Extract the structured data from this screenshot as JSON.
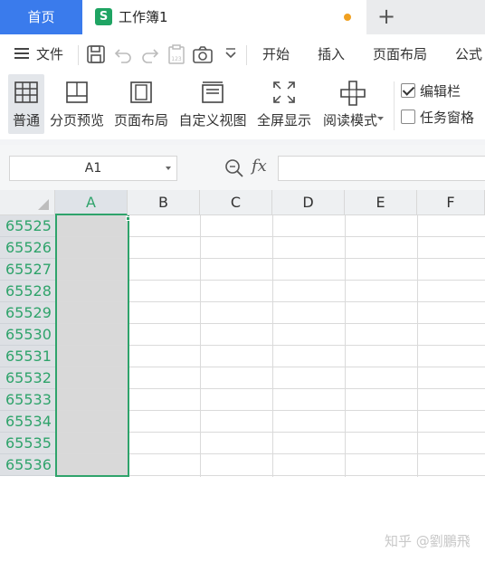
{
  "tabs": {
    "home_label": "首页",
    "doc_icon_letter": "S",
    "doc_title": "工作簿1",
    "new_tab_symbol": "+"
  },
  "menu": {
    "file_label": "文件",
    "items": [
      "开始",
      "插入",
      "页面布局",
      "公式"
    ]
  },
  "ribbon": {
    "buttons": [
      "普通",
      "分页预览",
      "页面布局",
      "自定义视图",
      "全屏显示",
      "阅读模式"
    ],
    "checkboxes": [
      {
        "label": "编辑栏",
        "checked": true
      },
      {
        "label": "任务窗格",
        "checked": false
      }
    ]
  },
  "formula_bar": {
    "name_box_value": "A1",
    "fx_label": "fx",
    "formula_value": ""
  },
  "grid": {
    "columns": [
      "A",
      "B",
      "C",
      "D",
      "E",
      "F"
    ],
    "selected_column": "A",
    "rows": [
      "65525",
      "65526",
      "65527",
      "65528",
      "65529",
      "65530",
      "65531",
      "65532",
      "65533",
      "65534",
      "65535",
      "65536"
    ]
  },
  "watermark": "知乎 @劉鵬飛",
  "colors": {
    "accent_blue": "#3a7bec",
    "accent_green": "#2fa36b",
    "unsaved_dot": "#f0a020"
  }
}
